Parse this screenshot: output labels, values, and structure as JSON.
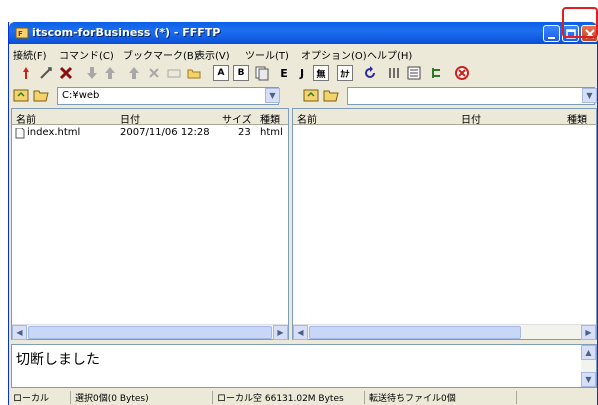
{
  "window": {
    "title": "itscom-forBusiness (*) - FFFTP"
  },
  "menubar": {
    "items": [
      "接続(F)",
      "コマンド(C)",
      "ブックマーク(B)",
      "表示(V)",
      "ツール(T)",
      "オプション(O)",
      "ヘルプ(H)"
    ]
  },
  "toolbar": {
    "text_buttons": [
      "A",
      "B",
      "E",
      "J",
      "無",
      "ｶﾅ"
    ]
  },
  "local": {
    "path": "C:¥web",
    "columns": [
      "名前",
      "日付",
      "サイズ",
      "種類"
    ],
    "files": [
      {
        "name": "index.html",
        "date": "2007/11/06 12:28",
        "size": "23",
        "type": "html"
      }
    ]
  },
  "remote": {
    "path": "",
    "columns": [
      "名前",
      "日付",
      "種類"
    ],
    "files": []
  },
  "log": {
    "message": "切断しました"
  },
  "status": {
    "mode": "ローカル",
    "selected": "選択0個(0 Bytes)",
    "local_free": "ローカル空 66131.02M Bytes",
    "queue": "転送待ちファイル0個"
  },
  "colors": {
    "title_blue": "#0a5fe6",
    "highlight_red": "#e02020",
    "chrome": "#ece9d8"
  }
}
